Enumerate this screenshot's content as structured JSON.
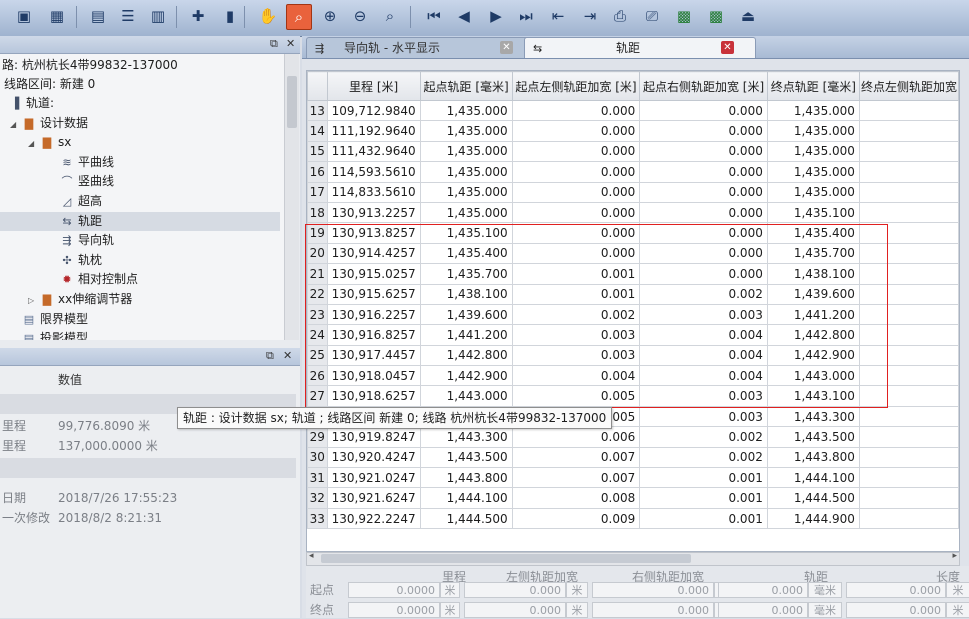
{
  "toolbar": {
    "buttons": [
      "save-icon",
      "grid-save-icon",
      "window-icon",
      "list-icon",
      "columns-icon",
      "add-icon",
      "delete-icon",
      "pan-icon",
      "zoom-box-icon",
      "zoom-in-icon",
      "zoom-out-icon",
      "zoom-fit-icon",
      "first-icon",
      "prev-icon",
      "next-icon",
      "last-icon",
      "insert-row-icon",
      "export-icon",
      "print-icon",
      "print-preview-icon",
      "excel-icon",
      "excel-export-icon",
      "exit-icon"
    ],
    "active_button": "zoom-box-icon"
  },
  "left_top_pane": {
    "info_line1": "路: 杭州杭长4带99832-137000",
    "info_line2": "线路区间: 新建 0",
    "tree": [
      {
        "label": "轨道:",
        "indent": 0,
        "icon": "rail-icon"
      },
      {
        "label": "设计数据",
        "indent": 1,
        "icon": "folder-icon",
        "expander": "▲"
      },
      {
        "label": "sx",
        "indent": 2,
        "icon": "folder-icon",
        "expander": "▲"
      },
      {
        "label": "平曲线",
        "indent": 3,
        "icon": "curve-icon"
      },
      {
        "label": "竖曲线",
        "indent": 3,
        "icon": "vertical-curve-icon"
      },
      {
        "label": "超高",
        "indent": 3,
        "icon": "superelevation-icon"
      },
      {
        "label": "轨距",
        "indent": 3,
        "icon": "gauge-icon",
        "selected": true
      },
      {
        "label": "导向轨",
        "indent": 3,
        "icon": "guide-rail-icon"
      },
      {
        "label": "轨枕",
        "indent": 3,
        "icon": "sleeper-icon"
      },
      {
        "label": "相对控制点",
        "indent": 3,
        "icon": "control-point-icon"
      },
      {
        "label": "xx伸缩调节器",
        "indent": 2,
        "icon": "folder-icon",
        "expander": "▷"
      },
      {
        "label": "限界模型",
        "indent": 1,
        "icon": "model-icon"
      },
      {
        "label": "投影模型",
        "indent": 1,
        "icon": "model-icon"
      }
    ]
  },
  "left_bottom_pane": {
    "header_value": "数值",
    "rows": [
      {
        "label": "里程",
        "value": "99,776.8090 米"
      },
      {
        "label": "里程",
        "value": "137,000.0000 米"
      },
      {
        "label": "日期",
        "value": "2018/7/26 17:55:23"
      },
      {
        "label": "一次修改",
        "value": "2018/8/2 8:21:31"
      }
    ]
  },
  "tabs": [
    {
      "label": "导向轨 - 水平显示",
      "active": false
    },
    {
      "label": "轨距",
      "active": true
    }
  ],
  "grid": {
    "columns": [
      "里程 [米]",
      "起点轨距 [毫米]",
      "起点左侧轨距加宽 [米]",
      "起点右侧轨距加宽 [米]",
      "终点轨距 [毫米]",
      "终点左侧轨距加宽"
    ],
    "rows": [
      {
        "n": "13",
        "m": "109,712.9840",
        "g1": "1,435.000",
        "l1": "0.000",
        "r1": "0.000",
        "g2": "1,435.000"
      },
      {
        "n": "14",
        "m": "111,192.9640",
        "g1": "1,435.000",
        "l1": "0.000",
        "r1": "0.000",
        "g2": "1,435.000"
      },
      {
        "n": "15",
        "m": "111,432.9640",
        "g1": "1,435.000",
        "l1": "0.000",
        "r1": "0.000",
        "g2": "1,435.000"
      },
      {
        "n": "16",
        "m": "114,593.5610",
        "g1": "1,435.000",
        "l1": "0.000",
        "r1": "0.000",
        "g2": "1,435.000"
      },
      {
        "n": "17",
        "m": "114,833.5610",
        "g1": "1,435.000",
        "l1": "0.000",
        "r1": "0.000",
        "g2": "1,435.000"
      },
      {
        "n": "18",
        "m": "130,913.2257",
        "g1": "1,435.000",
        "l1": "0.000",
        "r1": "0.000",
        "g2": "1,435.100"
      },
      {
        "n": "19",
        "m": "130,913.8257",
        "g1": "1,435.100",
        "l1": "0.000",
        "r1": "0.000",
        "g2": "1,435.400"
      },
      {
        "n": "20",
        "m": "130,914.4257",
        "g1": "1,435.400",
        "l1": "0.000",
        "r1": "0.000",
        "g2": "1,435.700"
      },
      {
        "n": "21",
        "m": "130,915.0257",
        "g1": "1,435.700",
        "l1": "0.001",
        "r1": "0.000",
        "g2": "1,438.100"
      },
      {
        "n": "22",
        "m": "130,915.6257",
        "g1": "1,438.100",
        "l1": "0.001",
        "r1": "0.002",
        "g2": "1,439.600"
      },
      {
        "n": "23",
        "m": "130,916.2257",
        "g1": "1,439.600",
        "l1": "0.002",
        "r1": "0.003",
        "g2": "1,441.200"
      },
      {
        "n": "24",
        "m": "130,916.8257",
        "g1": "1,441.200",
        "l1": "0.003",
        "r1": "0.004",
        "g2": "1,442.800"
      },
      {
        "n": "25",
        "m": "130,917.4457",
        "g1": "1,442.800",
        "l1": "0.003",
        "r1": "0.004",
        "g2": "1,442.900"
      },
      {
        "n": "26",
        "m": "130,918.0457",
        "g1": "1,442.900",
        "l1": "0.004",
        "r1": "0.004",
        "g2": "1,443.000"
      },
      {
        "n": "27",
        "m": "130,918.6257",
        "g1": "1,443.000",
        "l1": "0.005",
        "r1": "0.003",
        "g2": "1,443.100"
      },
      {
        "n": "28",
        "m": "",
        "g1": "",
        "l1": "0.005",
        "r1": "0.003",
        "g2": "1,443.300"
      },
      {
        "n": "29",
        "m": "130,919.8247",
        "g1": "1,443.300",
        "l1": "0.006",
        "r1": "0.002",
        "g2": "1,443.500"
      },
      {
        "n": "30",
        "m": "130,920.4247",
        "g1": "1,443.500",
        "l1": "0.007",
        "r1": "0.002",
        "g2": "1,443.800"
      },
      {
        "n": "31",
        "m": "130,921.0247",
        "g1": "1,443.800",
        "l1": "0.007",
        "r1": "0.001",
        "g2": "1,444.100"
      },
      {
        "n": "32",
        "m": "130,921.6247",
        "g1": "1,444.100",
        "l1": "0.008",
        "r1": "0.001",
        "g2": "1,444.500"
      },
      {
        "n": "33",
        "m": "130,922.2247",
        "g1": "1,444.500",
        "l1": "0.009",
        "r1": "0.001",
        "g2": "1,444.900"
      }
    ]
  },
  "tooltip": "轨距 : 设计数据 sx; 轨道 ; 线路区间 新建 0; 线路 杭州杭长4带99832-137000",
  "form": {
    "headers": [
      "里程",
      "左侧轨距加宽",
      "右侧轨距加宽",
      "轨距",
      "长度"
    ],
    "row_labels": [
      "起点",
      "终点"
    ],
    "mileage": "0.0000",
    "mileage_unit": "米",
    "left": "0.000",
    "left_unit": "米",
    "right": "0.000",
    "right_unit": "米",
    "gauge": "0.000",
    "gauge_unit": "毫米",
    "length": "0.000",
    "length_unit": "米"
  },
  "colors": {
    "selection_box": "#e02020",
    "active_tool": "#e9623c",
    "tab_close": "#c8323a"
  }
}
